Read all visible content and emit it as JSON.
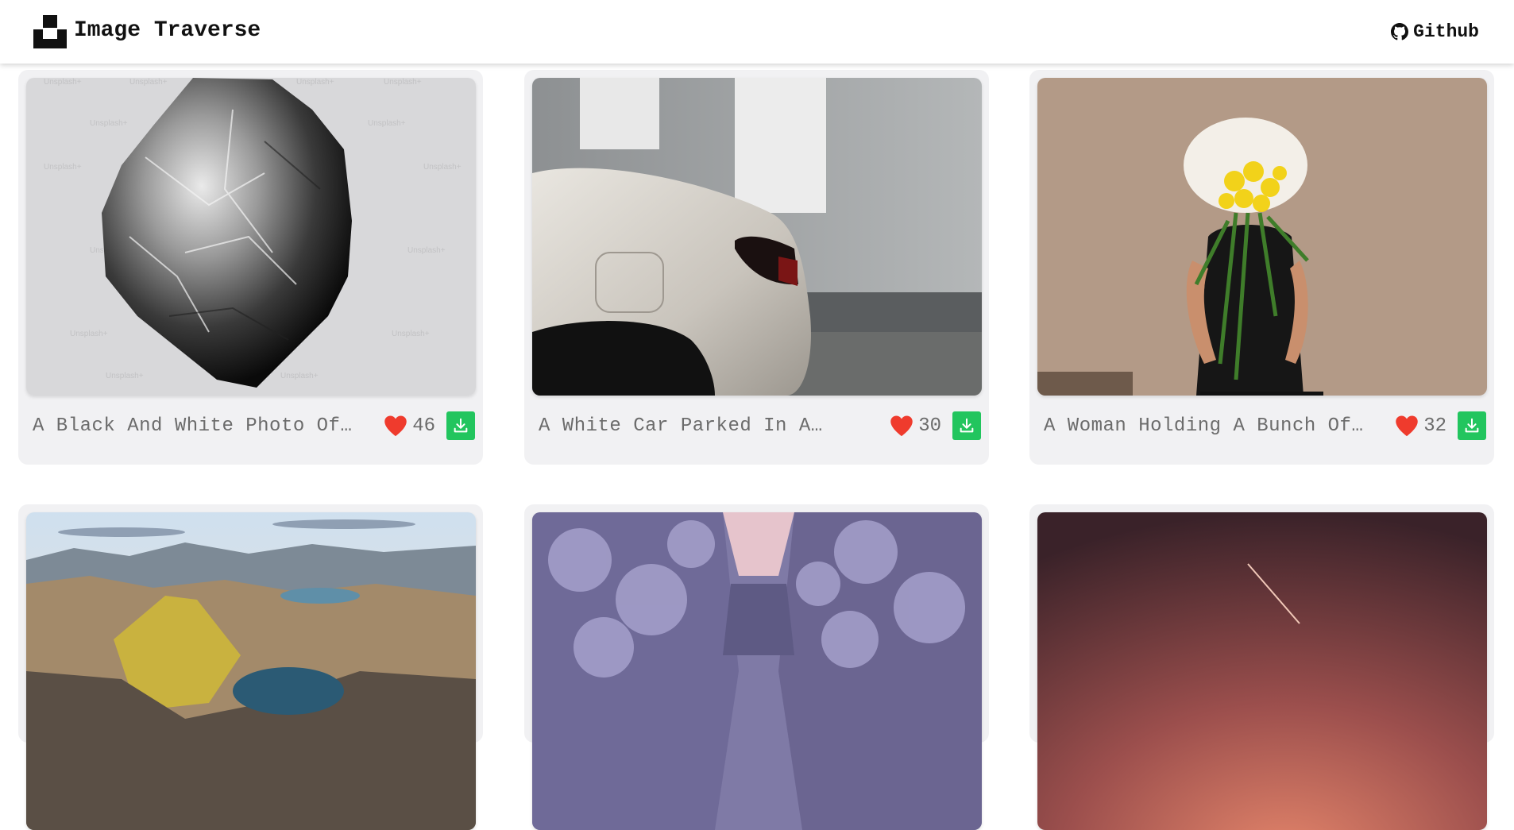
{
  "header": {
    "title": "Image Traverse",
    "github_label": "Github",
    "logo_icon": "unsplash-logo-icon",
    "github_icon": "github-icon"
  },
  "colors": {
    "like_heart": "#ef3b2d",
    "download_button": "#22c55e",
    "card_background": "#f1f1f3"
  },
  "cards": [
    {
      "caption": "A Black And White Photo Of…",
      "likes": "46",
      "icon": "heart-icon",
      "download_icon": "download-icon"
    },
    {
      "caption": "A White Car Parked In A…",
      "likes": "30",
      "icon": "heart-icon",
      "download_icon": "download-icon"
    },
    {
      "caption": "A Woman Holding A Bunch Of…",
      "likes": "32",
      "icon": "heart-icon",
      "download_icon": "download-icon"
    },
    {
      "caption": "",
      "likes": "",
      "icon": "heart-icon",
      "download_icon": "download-icon"
    },
    {
      "caption": "",
      "likes": "",
      "icon": "heart-icon",
      "download_icon": "download-icon"
    },
    {
      "caption": "",
      "likes": "",
      "icon": "heart-icon",
      "download_icon": "download-icon"
    }
  ],
  "watermark_text": "Unsplash+"
}
